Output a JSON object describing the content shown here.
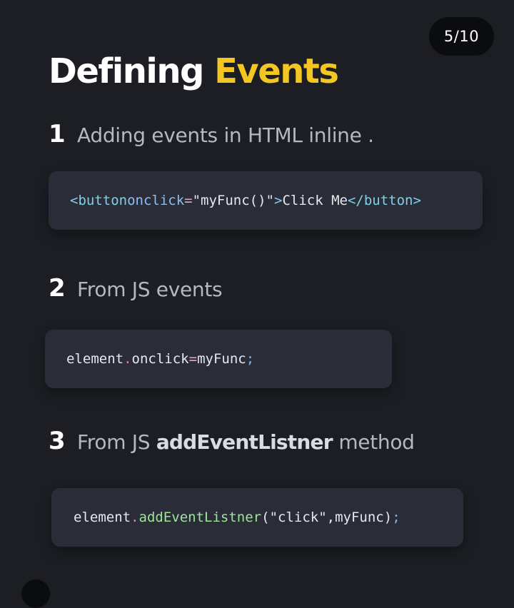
{
  "page_counter": "5/10",
  "title": {
    "main": "Defining ",
    "accent": "Events"
  },
  "steps": [
    {
      "number": "1",
      "text": "Adding events in HTML inline .",
      "code": {
        "open_tag": "<button",
        "attr": "onclick",
        "eq": "=",
        "value": "\"myFunc()\"",
        "close_bracket": ">",
        "inner": "Click Me",
        "end_tag": "</button>"
      }
    },
    {
      "number": "2",
      "text": "From JS events",
      "code": {
        "object": "element",
        "dot": ".",
        "property": "onclick",
        "op": "=",
        "handler": "myFunc",
        "semi": ";"
      }
    },
    {
      "number": "3",
      "text_before": "From JS ",
      "text_bold": "addEventListner",
      "text_after": " method",
      "code": {
        "object": "element",
        "dot": ".",
        "method": "addEventListner",
        "paren_open": "(",
        "arg1": "\"click\"",
        "comma": ",",
        "arg2": "myFunc",
        "paren_close": ")",
        "semi": ";"
      }
    }
  ],
  "colors": {
    "background": "#1c1e24",
    "accent": "#f3c623",
    "code_card": "#2a2d37"
  }
}
